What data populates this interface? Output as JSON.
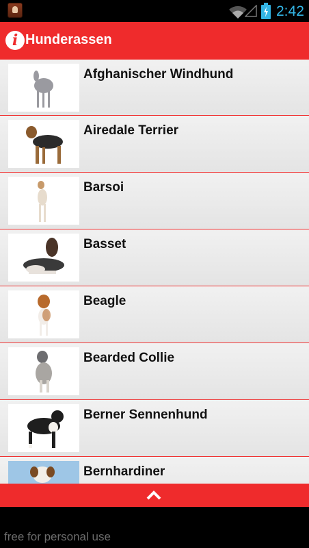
{
  "status_bar": {
    "time": "2:42",
    "notification_icon": "app-notification-icon",
    "wifi_icon": "wifi-icon",
    "signal_icon": "signal-icon",
    "battery_icon": "battery-charging-icon"
  },
  "action_bar": {
    "title": "Hunderassen",
    "icon": "info-icon",
    "background": "#ef2b2c"
  },
  "list": {
    "items": [
      {
        "name": "Afghanischer Windhund"
      },
      {
        "name": "Airedale Terrier"
      },
      {
        "name": "Barsoi"
      },
      {
        "name": "Basset"
      },
      {
        "name": "Beagle"
      },
      {
        "name": "Bearded Collie"
      },
      {
        "name": "Berner Sennenhund"
      },
      {
        "name": "Bernhardiner"
      }
    ]
  },
  "scroll_button": {
    "icon": "chevron-up-icon"
  },
  "footer": {
    "text": "free for personal use"
  },
  "colors": {
    "accent_red": "#ef2b2c",
    "clock_blue": "#33b5e5",
    "divider_red": "#f03131"
  }
}
